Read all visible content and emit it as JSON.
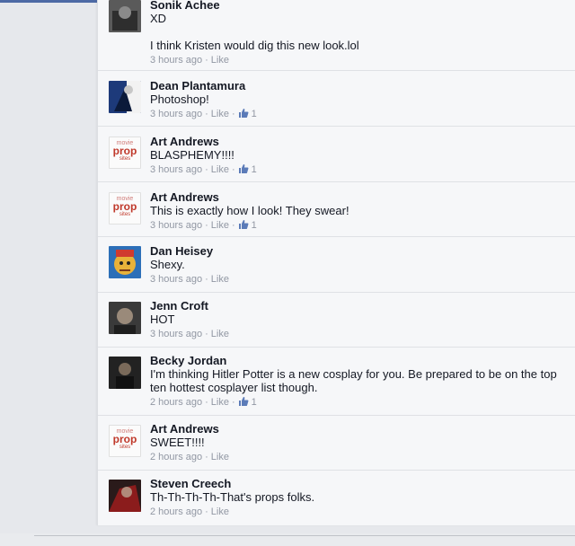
{
  "comments": [
    {
      "author": "Sonik Achee",
      "text": "XD\n\nI think Kristen would dig this new look.lol",
      "time": "3 hours ago",
      "like": "Like",
      "likes": "",
      "avatar": "photo-dark"
    },
    {
      "author": "Dean Plantamura",
      "text": "Photoshop!",
      "time": "3 hours ago",
      "like": "Like",
      "likes": "1",
      "avatar": "photo-blue"
    },
    {
      "author": "Art Andrews",
      "text": "BLASPHEMY!!!!",
      "time": "3 hours ago",
      "like": "Like",
      "likes": "1",
      "avatar": "logo"
    },
    {
      "author": "Art Andrews",
      "text": "This is exactly how I look!  They swear!",
      "time": "3 hours ago",
      "like": "Like",
      "likes": "1",
      "avatar": "logo"
    },
    {
      "author": "Dan Heisey",
      "text": "Shexy.",
      "time": "3 hours ago",
      "like": "Like",
      "likes": "",
      "avatar": "photo-cartoon"
    },
    {
      "author": "Jenn Croft",
      "text": "HOT",
      "time": "3 hours ago",
      "like": "Like",
      "likes": "",
      "avatar": "photo-dark"
    },
    {
      "author": "Becky Jordan",
      "text": "I'm thinking Hitler Potter is a new cosplay for you. Be prepared to be on the top ten hottest cosplayer  list though.",
      "time": "2 hours ago",
      "like": "Like",
      "likes": "1",
      "avatar": "photo-dark"
    },
    {
      "author": "Art Andrews",
      "text": "SWEET!!!!",
      "time": "2 hours ago",
      "like": "Like",
      "likes": "",
      "avatar": "logo"
    },
    {
      "author": "Steven Creech",
      "text": "Th-Th-Th-Th-That's props folks.",
      "time": "2 hours ago",
      "like": "Like",
      "likes": "",
      "avatar": "photo-red"
    }
  ],
  "logo": {
    "l1": "movie",
    "l2": "prop",
    "l3": "sites"
  },
  "colors": {
    "name": "#141823",
    "meta": "#9197a3",
    "link": "#4d6aa5",
    "panel": "#f6f7f9"
  },
  "icons": {
    "like_count": "thumbs-up-icon"
  }
}
